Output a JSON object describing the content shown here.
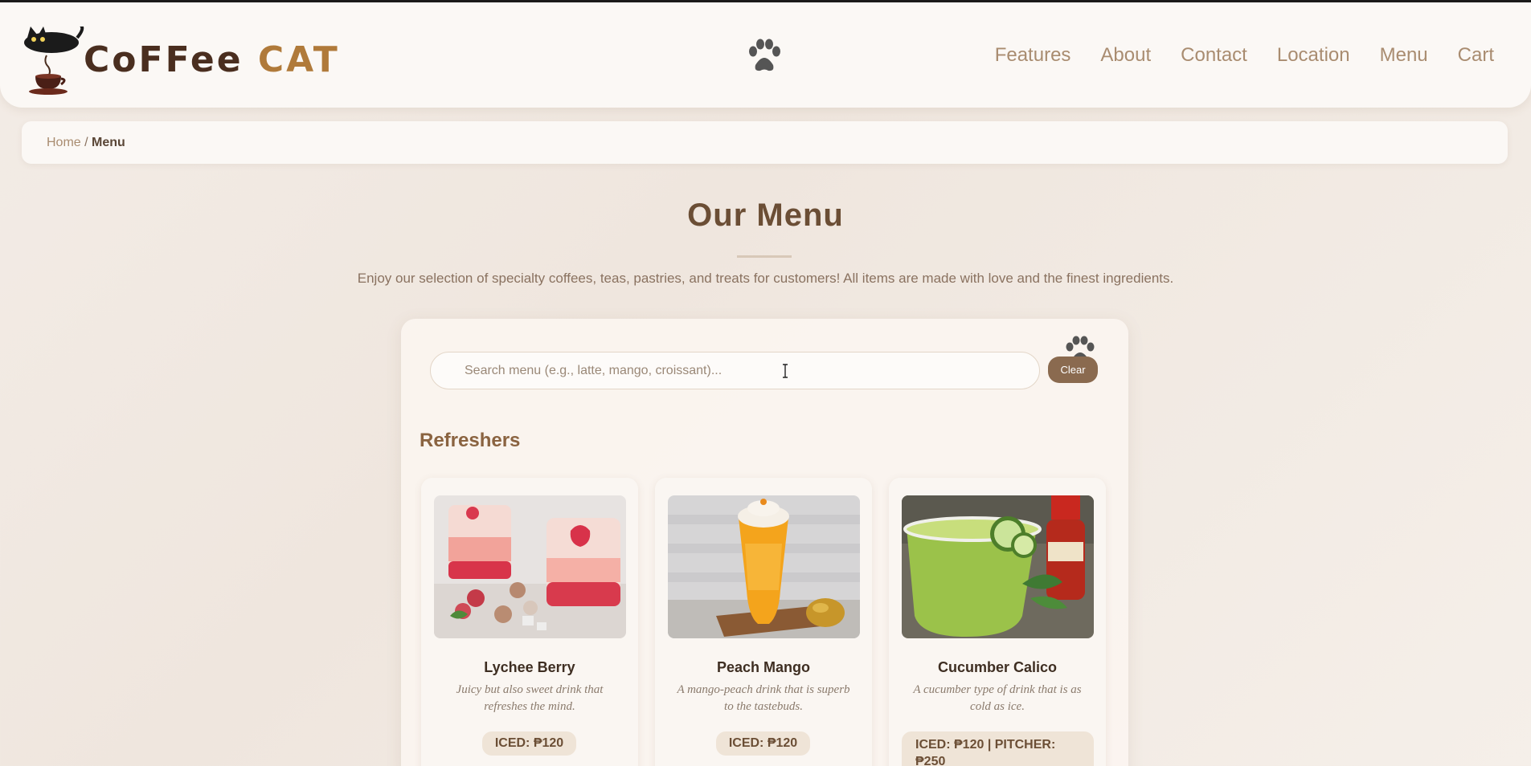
{
  "header": {
    "logo_text_primary": "CoFFee",
    "logo_text_secondary": "CAT",
    "nav": [
      {
        "label": "Features"
      },
      {
        "label": "About"
      },
      {
        "label": "Contact"
      },
      {
        "label": "Location"
      },
      {
        "label": "Menu"
      },
      {
        "label": "Cart"
      }
    ]
  },
  "breadcrumb": {
    "home": "Home",
    "separator": " / ",
    "current": "Menu"
  },
  "intro": {
    "title": "Our Menu",
    "subtitle": "Enjoy our selection of specialty coffees, teas, pastries, and treats for customers! All items are made with love and the finest ingredients."
  },
  "search": {
    "value": "",
    "placeholder": "Search menu (e.g., latte, mango, croissant)...",
    "clear_label": "Clear"
  },
  "section": {
    "title": "Refreshers",
    "items": [
      {
        "name": "Lychee Berry",
        "description": "Juicy but also sweet drink that refreshes the mind.",
        "price": "ICED: ₱120",
        "image": "lychee-berry-drink"
      },
      {
        "name": "Peach Mango",
        "description": "A mango-peach drink that is superb to the tastebuds.",
        "price": "ICED: ₱120",
        "image": "peach-mango-drink"
      },
      {
        "name": "Cucumber Calico",
        "description": "A cucumber type of drink that is as cold as ice.",
        "price": "ICED: ₱120 | PITCHER: ₱250",
        "image": "cucumber-calico-drink"
      }
    ]
  },
  "colors": {
    "accent": "#8a6a4f",
    "nav_text": "#a98c70",
    "title": "#6b4e35",
    "background": "#f3ece6"
  }
}
